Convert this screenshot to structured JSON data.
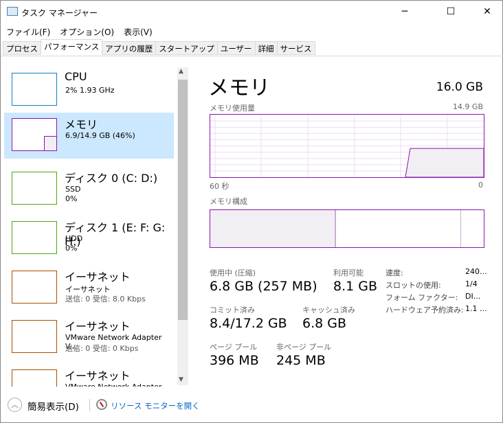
{
  "window": {
    "title": "タスク マネージャー",
    "minimize": "─",
    "maximize": "☐",
    "close": "✕"
  },
  "menu": [
    "ファイル(F)",
    "オプション(O)",
    "表示(V)"
  ],
  "tabs": [
    {
      "label": "プロセス"
    },
    {
      "label": "パフォーマンス",
      "active": true
    },
    {
      "label": "アプリの履歴"
    },
    {
      "label": "スタートアップ"
    },
    {
      "label": "ユーザー"
    },
    {
      "label": "詳細"
    },
    {
      "label": "サービス"
    }
  ],
  "sidebar": [
    {
      "name": "CPU",
      "line1": "2%  1.93 GHz",
      "line2": "",
      "color": "#117dbb"
    },
    {
      "name": "メモリ",
      "line1": "6.9/14.9 GB (46%)",
      "line2": "",
      "color": "#8b12ae"
    },
    {
      "name": "ディスク 0 (C: D:)",
      "line1": "SSD",
      "line2": "0%",
      "color": "#4da60c"
    },
    {
      "name": "ディスク 1 (E: F: G: H:)",
      "line1": "HDD",
      "line2": "0%",
      "color": "#4da60c"
    },
    {
      "name": "イーサネット",
      "line1": "イーサネット",
      "line2": "送信: 0 受信: 8.0 Kbps",
      "color": "#a74f01"
    },
    {
      "name": "イーサネット",
      "line1": "VMware Network Adapter V...",
      "line2": "送信: 0 受信: 0 Kbps",
      "color": "#a74f01"
    },
    {
      "name": "イーサネット",
      "line1": "VMware Network Adapter V...",
      "line2": "",
      "color": "#a74f01"
    }
  ],
  "main": {
    "title": "メモリ",
    "total": "16.0 GB",
    "usage_label": "メモリ使用量",
    "usage_max": "14.9 GB",
    "time_left": "60 秒",
    "time_right": "0",
    "usage_percent": 46,
    "composition_label": "メモリ構成",
    "stats": {
      "in_use_label": "使用中 (圧縮)",
      "in_use": "6.8 GB (257 MB)",
      "available_label": "利用可能",
      "available": "8.1 GB",
      "committed_label": "コミット済み",
      "committed": "8.4/17.2 GB",
      "cached_label": "キャッシュ済み",
      "cached": "6.8 GB",
      "paged_label": "ページ プール",
      "paged": "396 MB",
      "nonpaged_label": "非ページ プール",
      "nonpaged": "245 MB"
    },
    "props": [
      {
        "k": "速度:",
        "v": "240..."
      },
      {
        "k": "スロットの使用:",
        "v": "1/4"
      },
      {
        "k": "フォーム ファクター:",
        "v": "DI..."
      },
      {
        "k": "ハードウェア予約済み:",
        "v": "1.1 ..."
      }
    ]
  },
  "footer": {
    "fewer": "簡易表示(D)",
    "resmon": "リソース モニターを開く"
  }
}
